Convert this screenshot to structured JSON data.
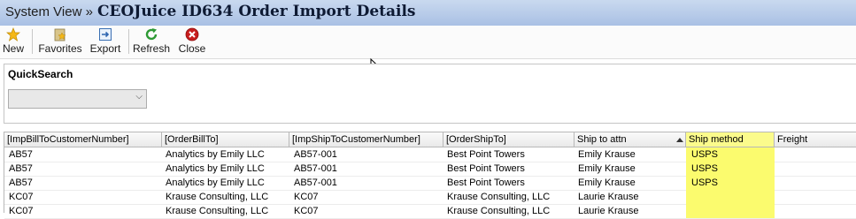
{
  "title_bar": {
    "breadcrumb": "System View »",
    "title": "CEOJuice ID634 Order Import Details"
  },
  "toolbar": {
    "items": [
      {
        "label": "New",
        "icon": "star-icon"
      },
      {
        "label": "Favorites",
        "icon": "favorites-icon"
      },
      {
        "label": "Export",
        "icon": "export-icon"
      },
      {
        "label": "Refresh",
        "icon": "refresh-icon"
      },
      {
        "label": "Close",
        "icon": "close-icon"
      }
    ]
  },
  "quicksearch": {
    "label": "QuickSearch",
    "selected": ""
  },
  "grid": {
    "columns": [
      "[ImpBillToCustomerNumber]",
      "[OrderBillTo]",
      "[ImpShipToCustomerNumber]",
      "[OrderShipTo]",
      "Ship to attn",
      "Ship method",
      "Freight"
    ],
    "sorted_column": "Ship to attn",
    "highlight_color": "#fbfb6e",
    "rows": [
      [
        "AB57",
        "Analytics by Emily LLC",
        "AB57-001",
        "Best Point Towers",
        "Emily Krause",
        "USPS",
        ""
      ],
      [
        "AB57",
        "Analytics by Emily LLC",
        "AB57-001",
        "Best Point Towers",
        "Emily Krause",
        "USPS",
        ""
      ],
      [
        "AB57",
        "Analytics by Emily LLC",
        "AB57-001",
        "Best Point Towers",
        "Emily Krause",
        "USPS",
        ""
      ],
      [
        "KC07",
        "Krause Consulting, LLC",
        "KC07",
        "Krause Consulting, LLC",
        "Laurie Krause",
        "",
        ""
      ],
      [
        "KC07",
        "Krause Consulting, LLC",
        "KC07",
        "Krause Consulting, LLC",
        "Laurie Krause",
        "",
        ""
      ]
    ]
  }
}
